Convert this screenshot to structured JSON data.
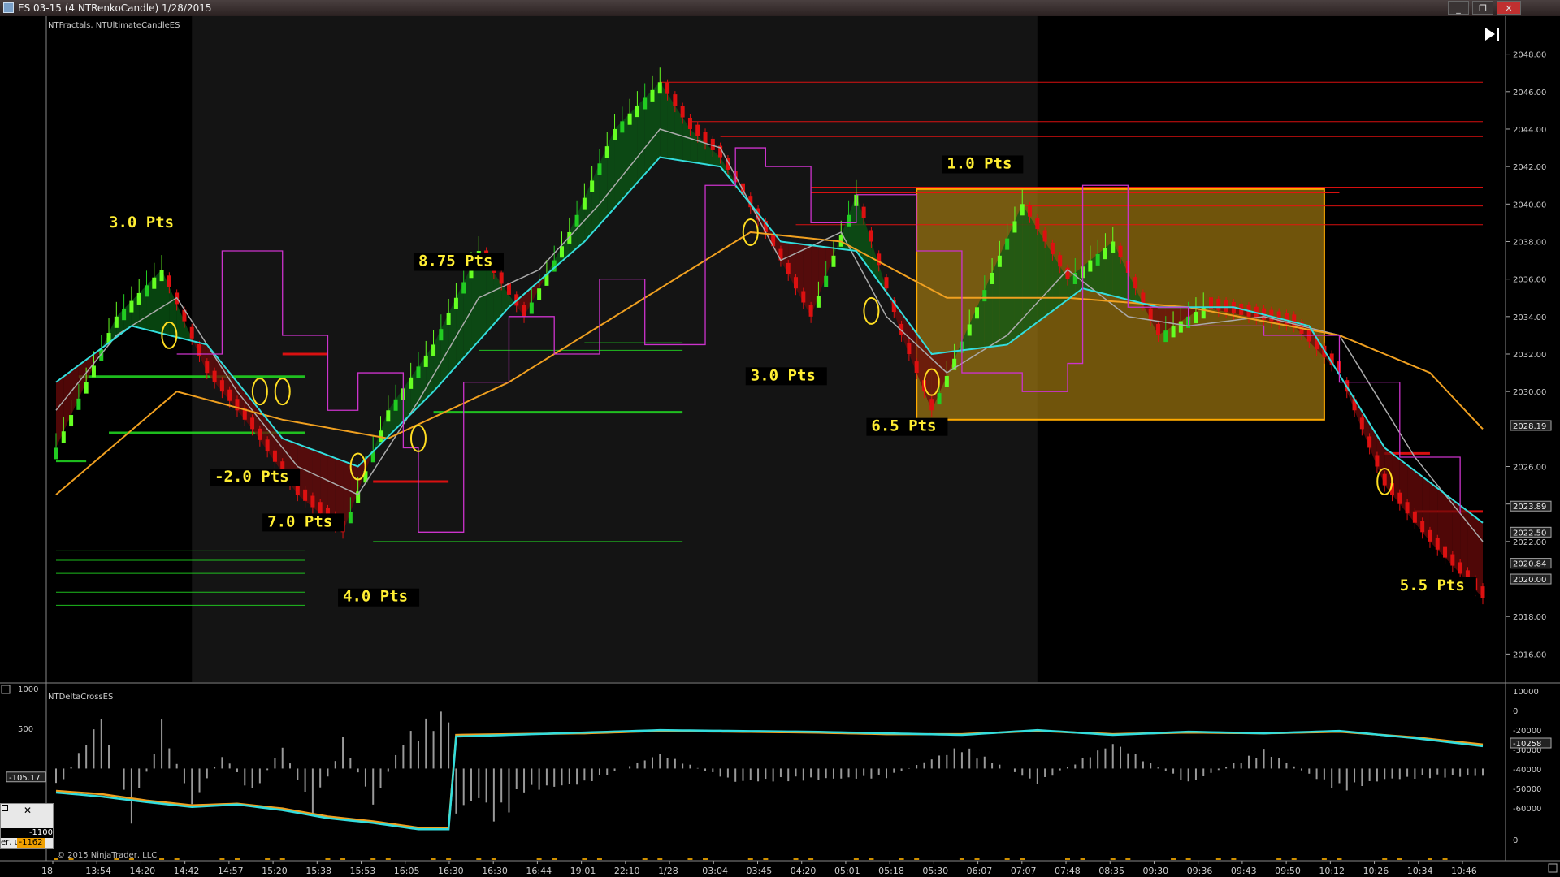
{
  "window": {
    "title": "ES 03-15 (4 NTRenkoCandle)  1/28/2015",
    "minimize_label": "_",
    "restore_label": "❐",
    "close_label": "✕"
  },
  "colors": {
    "background": "#000000",
    "session_shade": "#141414",
    "up_bar": "#22cc22",
    "up_bar_bright": "#66ff22",
    "down_bar": "#dd1111",
    "yellow_bar": "#ffdd22",
    "cyan_ma": "#33dddd",
    "orange_ma": "#f0a020",
    "gray_ma": "#aaaaaa",
    "magenta_line": "#cc33cc",
    "support_line": "#22dd22",
    "resistance_line": "#ee1111",
    "annotation_text": "#ffee33",
    "box_fill": "#a07810",
    "box_border": "#ffaa00"
  },
  "price_panel": {
    "indicator_label": "NTFractals, NTUltimateCandleES",
    "end_icon": "skip-to-end-icon",
    "y_range": [
      2014.5,
      2049.5
    ],
    "y_ticks": [
      "2048.00",
      "2046.00",
      "2044.00",
      "2042.00",
      "2040.00",
      "2038.00",
      "2036.00",
      "2034.00",
      "2032.00",
      "2030.00",
      "2026.00",
      "2024.00",
      "2022.00",
      "2018.00",
      "2016.00"
    ],
    "price_markers": [
      {
        "label": "2028.19",
        "value": 2028.19
      },
      {
        "label": "2023.89",
        "value": 2023.89
      },
      {
        "label": "2022.50",
        "value": 2022.5
      },
      {
        "label": "2020.84",
        "value": 2020.84
      },
      {
        "label": "2020.00",
        "value": 2020.0
      }
    ]
  },
  "delta_panel": {
    "indicator_label": "NTDeltaCrossES",
    "left_ticks": [
      "1000",
      "500",
      "-500"
    ],
    "left_marker": "-105.17",
    "right_ticks": [
      "10000",
      "0",
      "-20000",
      "-30000",
      "-40000",
      "-50000",
      "-60000",
      "0"
    ],
    "right_marker": "-10258"
  },
  "mini_panel": {
    "value1": "-1100",
    "value2": "-1162",
    "prefix": "er, u"
  },
  "time_axis": {
    "labels": [
      "18",
      "13:54",
      "14:20",
      "14:42",
      "14:57",
      "15:20",
      "15:38",
      "15:53",
      "16:05",
      "16:30",
      "16:30",
      "16:44",
      "19:01",
      "22:10",
      "1/28",
      "03:04",
      "03:45",
      "04:20",
      "05:01",
      "05:18",
      "05:30",
      "06:07",
      "07:07",
      "07:48",
      "08:35",
      "09:30",
      "09:36",
      "09:43",
      "09:50",
      "10:12",
      "10:26",
      "10:34",
      "10:46"
    ],
    "copyright": "© 2015 NinjaTrader, LLC"
  },
  "annotations": [
    {
      "text": "3.0  Pts",
      "bar": 7,
      "price": 2038.75
    },
    {
      "text": "8.75  Pts",
      "bar": 48,
      "price": 2036.7
    },
    {
      "text": "-2.0  Pts",
      "bar": 21,
      "price": 2025.2
    },
    {
      "text": "7.0  Pts",
      "bar": 28,
      "price": 2022.8
    },
    {
      "text": "4.0  Pts",
      "bar": 38,
      "price": 2018.8
    },
    {
      "text": "3.0  Pts",
      "bar": 92,
      "price": 2030.6
    },
    {
      "text": "6.5  Pts",
      "bar": 108,
      "price": 2027.9
    },
    {
      "text": "1.0  Pts",
      "bar": 118,
      "price": 2041.9
    },
    {
      "text": "5.5  Pts",
      "bar": 178,
      "price": 2019.4
    }
  ],
  "chart_data": {
    "type": "candlestick",
    "bar_count": 190,
    "y_range": [
      2014.5,
      2049.5
    ],
    "series": [
      {
        "name": "price",
        "bar": [
          0,
          8,
          14,
          20,
          26,
          32,
          38,
          44,
          50,
          56,
          62,
          68,
          74,
          80,
          84,
          88,
          94,
          100,
          106,
          112,
          116,
          122,
          128,
          134,
          140,
          146,
          152,
          158,
          164,
          170,
          176,
          182,
          189
        ],
        "price": [
          2027.0,
          2034.0,
          2036.5,
          2031.0,
          2028.0,
          2024.5,
          2022.5,
          2029.0,
          2032.5,
          2037.5,
          2034.0,
          2038.5,
          2044.0,
          2046.5,
          2044.0,
          2042.5,
          2038.5,
          2034.0,
          2040.5,
          2033.0,
          2029.0,
          2034.5,
          2040.0,
          2036.0,
          2038.0,
          2033.0,
          2034.5,
          2034.0,
          2033.5,
          2031.0,
          2025.0,
          2022.0,
          2019.0
        ]
      },
      {
        "name": "ma_fast",
        "bar": [
          0,
          10,
          20,
          30,
          40,
          50,
          60,
          70,
          80,
          88,
          96,
          106,
          116,
          126,
          136,
          146,
          156,
          166,
          176,
          189
        ],
        "price": [
          2030.5,
          2033.5,
          2032.5,
          2027.5,
          2026.0,
          2030.0,
          2034.5,
          2038.0,
          2042.5,
          2042.0,
          2038.0,
          2037.5,
          2032.0,
          2032.5,
          2035.5,
          2034.5,
          2034.5,
          2033.5,
          2027.0,
          2023.0
        ]
      },
      {
        "name": "ma_slow",
        "bar": [
          0,
          16,
          30,
          44,
          60,
          76,
          92,
          104,
          118,
          134,
          150,
          170,
          182,
          189
        ],
        "price": [
          2024.5,
          2030.0,
          2028.5,
          2027.5,
          2030.5,
          2034.5,
          2038.5,
          2038.0,
          2035.0,
          2035.0,
          2034.5,
          2033.0,
          2031.0,
          2028.0
        ]
      },
      {
        "name": "ma_gray",
        "bar": [
          0,
          8,
          16,
          24,
          32,
          40,
          48,
          56,
          64,
          72,
          80,
          88,
          96,
          104,
          110,
          118,
          126,
          134,
          142,
          150,
          160,
          170,
          180,
          189
        ],
        "price": [
          2029.0,
          2033.0,
          2035.0,
          2030.0,
          2026.0,
          2024.5,
          2029.5,
          2035.0,
          2036.5,
          2040.0,
          2044.0,
          2043.0,
          2037.0,
          2038.5,
          2034.0,
          2031.0,
          2033.0,
          2036.5,
          2034.0,
          2033.5,
          2034.0,
          2033.0,
          2026.5,
          2022.0
        ]
      },
      {
        "name": "magenta_step",
        "bar": [
          16,
          22,
          30,
          36,
          40,
          46,
          48,
          54,
          60,
          66,
          72,
          78,
          86,
          90,
          94,
          100,
          106,
          114,
          120,
          128,
          134,
          136,
          142,
          150,
          160,
          170,
          178,
          186
        ],
        "price": [
          2032.0,
          2037.5,
          2033.0,
          2029.0,
          2031.0,
          2027.0,
          2022.5,
          2030.5,
          2034.0,
          2032.0,
          2036.0,
          2032.5,
          2041.0,
          2043.0,
          2042.0,
          2039.0,
          2040.5,
          2037.5,
          2031.0,
          2030.0,
          2031.5,
          2041.0,
          2034.5,
          2033.5,
          2033.0,
          2030.5,
          2026.5,
          2023.5
        ]
      }
    ],
    "support_levels": [
      {
        "price": 2026.3,
        "from": 0,
        "to": 4
      },
      {
        "price": 2027.8,
        "from": 7,
        "to": 33
      },
      {
        "price": 2030.8,
        "from": 3,
        "to": 33
      },
      {
        "price": 2028.9,
        "from": 50,
        "to": 83
      },
      {
        "price": 2032.2,
        "from": 56,
        "to": 83
      },
      {
        "price": 2032.6,
        "from": 70,
        "to": 83
      },
      {
        "price": 2022.0,
        "from": 42,
        "to": 83
      },
      {
        "price": 2021.5,
        "from": 0,
        "to": 33
      },
      {
        "price": 2021.0,
        "from": 0,
        "to": 33
      },
      {
        "price": 2020.3,
        "from": 0,
        "to": 33
      },
      {
        "price": 2019.3,
        "from": 0,
        "to": 33
      },
      {
        "price": 2018.6,
        "from": 0,
        "to": 33
      }
    ],
    "resistance_levels": [
      {
        "price": 2046.5,
        "from": 80,
        "to": 189
      },
      {
        "price": 2044.4,
        "from": 84,
        "to": 189
      },
      {
        "price": 2043.6,
        "from": 88,
        "to": 189
      },
      {
        "price": 2040.9,
        "from": 100,
        "to": 189
      },
      {
        "price": 2040.6,
        "from": 100,
        "to": 170
      },
      {
        "price": 2039.9,
        "from": 128,
        "to": 189
      },
      {
        "price": 2038.9,
        "from": 98,
        "to": 189
      },
      {
        "price": 2032.0,
        "from": 30,
        "to": 36
      },
      {
        "price": 2025.2,
        "from": 42,
        "to": 52
      },
      {
        "price": 2026.7,
        "from": 176,
        "to": 182
      },
      {
        "price": 2023.6,
        "from": 180,
        "to": 189
      }
    ],
    "highlight_box": {
      "from_bar": 114,
      "to_bar": 168,
      "top": 2040.8,
      "bottom": 2028.5
    },
    "signal_circles": [
      {
        "bar": 15,
        "price": 2033.0
      },
      {
        "bar": 27,
        "price": 2030.0
      },
      {
        "bar": 30,
        "price": 2030.0
      },
      {
        "bar": 40,
        "price": 2026.0
      },
      {
        "bar": 48,
        "price": 2027.5
      },
      {
        "bar": 92,
        "price": 2038.5
      },
      {
        "bar": 108,
        "price": 2034.3
      },
      {
        "bar": 116,
        "price": 2030.5
      },
      {
        "bar": 176,
        "price": 2025.2
      }
    ],
    "delta_series": {
      "bar": [
        0,
        6,
        12,
        18,
        24,
        30,
        36,
        42,
        48,
        52,
        53,
        60,
        70,
        80,
        90,
        100,
        110,
        120,
        130,
        140,
        150,
        160,
        170,
        180,
        189
      ],
      "fast": [
        -300,
        -350,
        -420,
        -480,
        -450,
        -520,
        -620,
        -680,
        -760,
        -760,
        400,
        420,
        450,
        480,
        470,
        460,
        440,
        420,
        480,
        420,
        460,
        440,
        470,
        380,
        280
      ],
      "slow": [
        -280,
        -320,
        -400,
        -460,
        -440,
        -500,
        -600,
        -660,
        -740,
        -740,
        420,
        430,
        440,
        470,
        460,
        450,
        430,
        430,
        470,
        430,
        450,
        440,
        460,
        390,
        300
      ]
    },
    "delta_histogram_envelope": {
      "bar": [
        0,
        6,
        10,
        14,
        18,
        22,
        26,
        30,
        34,
        38,
        42,
        46,
        50,
        52,
        53,
        56,
        58,
        60,
        62,
        70,
        80,
        90,
        100,
        110,
        120,
        130,
        140,
        150,
        160,
        170,
        176,
        182,
        189
      ],
      "value": [
        -300,
        700,
        -700,
        620,
        -500,
        200,
        -350,
        300,
        -600,
        400,
        -500,
        400,
        700,
        750,
        -600,
        -400,
        -680,
        -550,
        -300,
        -200,
        200,
        -180,
        -150,
        -120,
        300,
        -200,
        350,
        -200,
        250,
        -300,
        -150,
        -120,
        -100
      ]
    },
    "delta_range": [
      -950,
      1050
    ]
  }
}
